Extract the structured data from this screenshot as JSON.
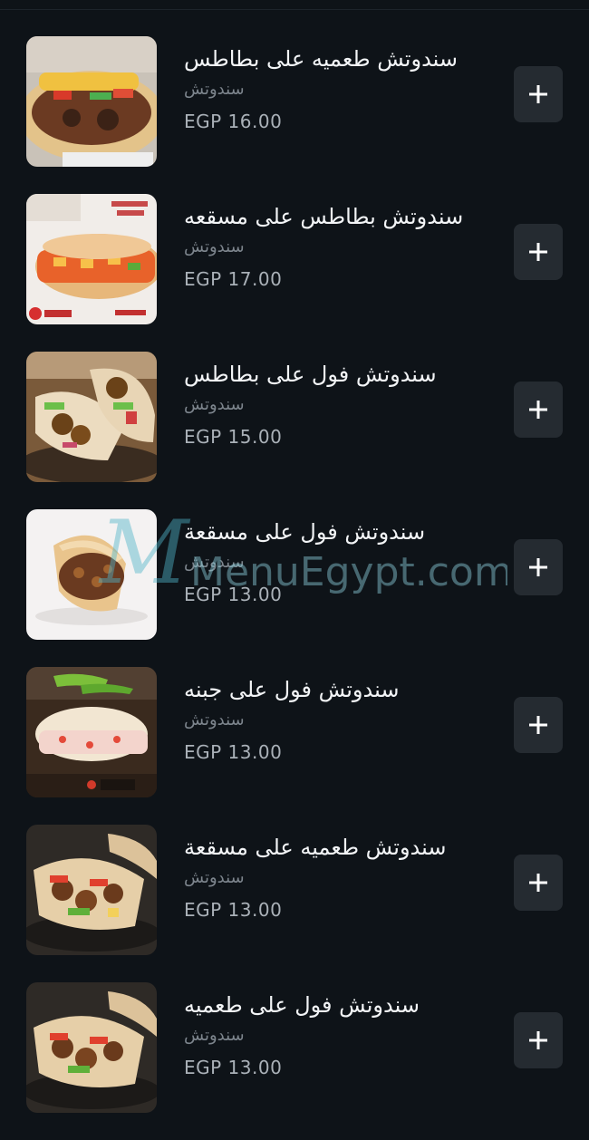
{
  "items": [
    {
      "name": "سندوتش طعميه على بطاطس",
      "category": "سندوتش",
      "price": "EGP 16.00",
      "image": "falafel-potato-sandwich"
    },
    {
      "name": "سندوتش بطاطس على مسقعه",
      "category": "سندوتش",
      "price": "EGP 17.00",
      "image": "potato-moussaka-sandwich"
    },
    {
      "name": "سندوتش فول على بطاطس",
      "category": "سندوتش",
      "price": "EGP 15.00",
      "image": "foul-potato-sandwich"
    },
    {
      "name": "سندوتش فول على مسقعة",
      "category": "سندوتش",
      "price": "EGP 13.00",
      "image": "foul-moussaka-sandwich"
    },
    {
      "name": "سندوتش فول على جبنه",
      "category": "سندوتش",
      "price": "EGP 13.00",
      "image": "foul-cheese-sandwich"
    },
    {
      "name": "سندوتش طعميه على مسقعة",
      "category": "سندوتش",
      "price": "EGP 13.00",
      "image": "falafel-moussaka-sandwich"
    },
    {
      "name": "سندوتش فول على طعميه",
      "category": "سندوتش",
      "price": "EGP 13.00",
      "image": "foul-falafel-sandwich"
    }
  ],
  "watermark": "MenuEgypt.com",
  "colors": {
    "background": "#0e1318",
    "button": "#252b31",
    "accent": "#4fb3c8"
  },
  "icons": {
    "add": "plus-icon"
  }
}
